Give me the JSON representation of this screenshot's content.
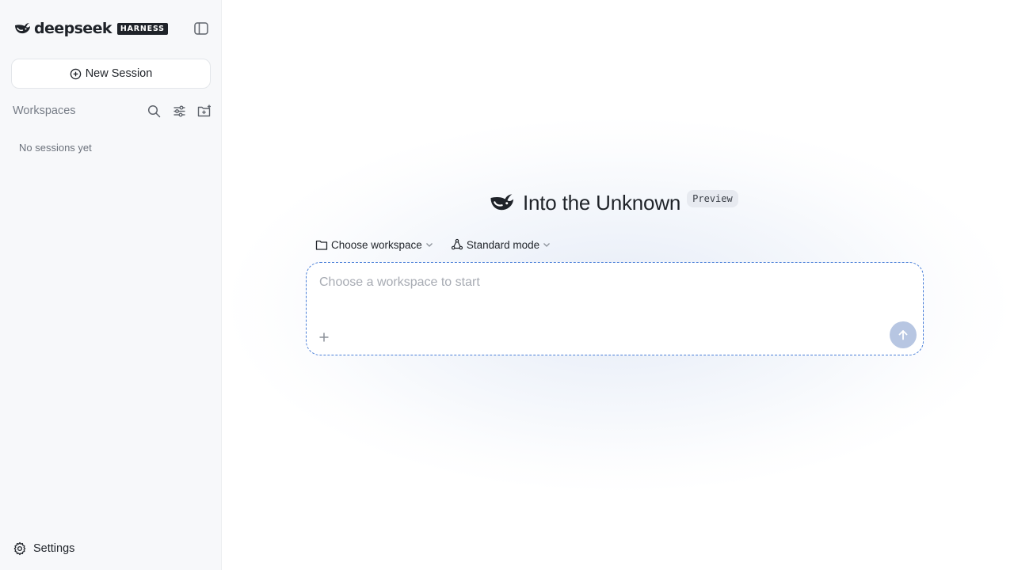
{
  "sidebar": {
    "brand_name": "deepseek",
    "brand_tag": "HARNESS",
    "new_session_label": "New Session",
    "workspaces_title": "Workspaces",
    "empty_text": "No sessions yet",
    "settings_label": "Settings",
    "icons": [
      "sidebar-toggle-icon",
      "plus-circle-icon",
      "search-icon",
      "filter-sliders-icon",
      "new-folder-icon",
      "gear-icon"
    ]
  },
  "main": {
    "hero_title": "Into the Unknown",
    "preview_badge": "Preview",
    "workspace_select": "Choose workspace",
    "mode_select": "Standard mode",
    "input_placeholder": "Choose a workspace to start",
    "icons": [
      "whale-logo-icon",
      "folder-icon",
      "mode-icon",
      "chevron-down-icon",
      "plus-icon",
      "arrow-up-icon"
    ]
  },
  "colors": {
    "accent": "#4a7fd8",
    "send_disabled": "#b7c6e2",
    "sidebar_bg": "#f7f8fa"
  }
}
